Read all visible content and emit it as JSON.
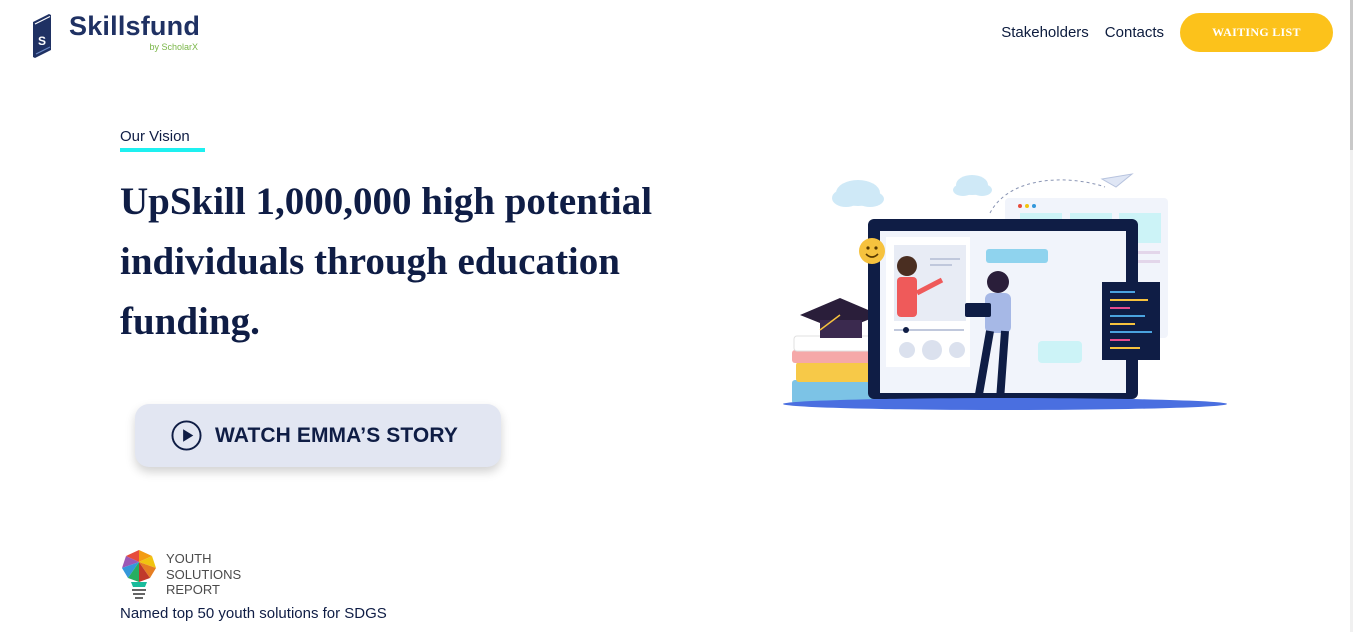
{
  "header": {
    "brand_name": "Skillsfund",
    "brand_sub": "by ScholarX",
    "nav": [
      {
        "label": "Stakeholders"
      },
      {
        "label": "Contacts"
      }
    ],
    "cta_label": "WAITING LIST"
  },
  "hero": {
    "eyebrow": "Our Vision",
    "headline": {
      "part1": "UpSkill ",
      "bold1": "1,000,000 high potential individuals",
      "part2": " through education funding."
    },
    "story_button_label": "WATCH EMMA’S STORY"
  },
  "award": {
    "title": "YOUTH SOLUTIONS REPORT",
    "caption": "Named top 50 youth solutions for SDGS"
  },
  "colors": {
    "accent_yellow": "#fcc21b",
    "brand_navy": "#1f3163",
    "underline_cyan": "#1ef0f0",
    "button_bg": "#e2e6f2"
  },
  "icons": [
    "book-logo-icon",
    "play-icon",
    "lightbulb-logo-icon",
    "online-learning-illustration"
  ]
}
